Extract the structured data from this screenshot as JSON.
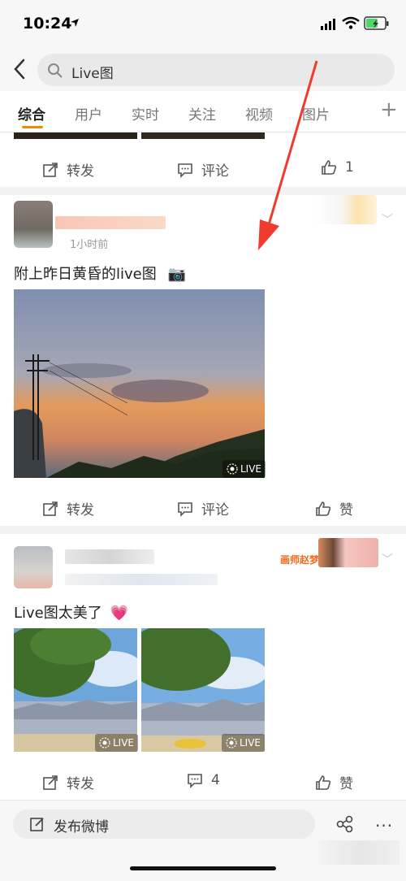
{
  "status": {
    "time": "10:24"
  },
  "search": {
    "query": "Live图"
  },
  "tabs": [
    {
      "label": "综合",
      "active": true
    },
    {
      "label": "用户"
    },
    {
      "label": "实时"
    },
    {
      "label": "关注"
    },
    {
      "label": "视频"
    },
    {
      "label": "图片"
    }
  ],
  "tab_add": "+",
  "post0": {
    "repost": "转发",
    "comment": "评论",
    "like": "1"
  },
  "post1": {
    "time": "1小时前",
    "text": "附上昨日黄昏的live图",
    "live_label": "LIVE",
    "repost": "转发",
    "comment": "评论",
    "like": "赞"
  },
  "post2": {
    "text": "Live图太美了",
    "sticker_text": "画师赵梦",
    "live_label": "LIVE",
    "repost": "转发",
    "comment": "4",
    "like": "赞"
  },
  "bottom": {
    "compose": "发布微博",
    "more": "···"
  },
  "colors": {
    "accent": "#ff8200",
    "arrow": "#f03a2e"
  },
  "icons": [
    "location-arrow-icon",
    "signal-icon",
    "wifi-icon",
    "battery-icon",
    "back-icon",
    "search-icon",
    "repost-icon",
    "comment-icon",
    "like-icon",
    "camera-emoji",
    "heart-emoji",
    "live-icon",
    "compose-icon",
    "share-icon",
    "more-icon",
    "chevron-down-icon"
  ]
}
